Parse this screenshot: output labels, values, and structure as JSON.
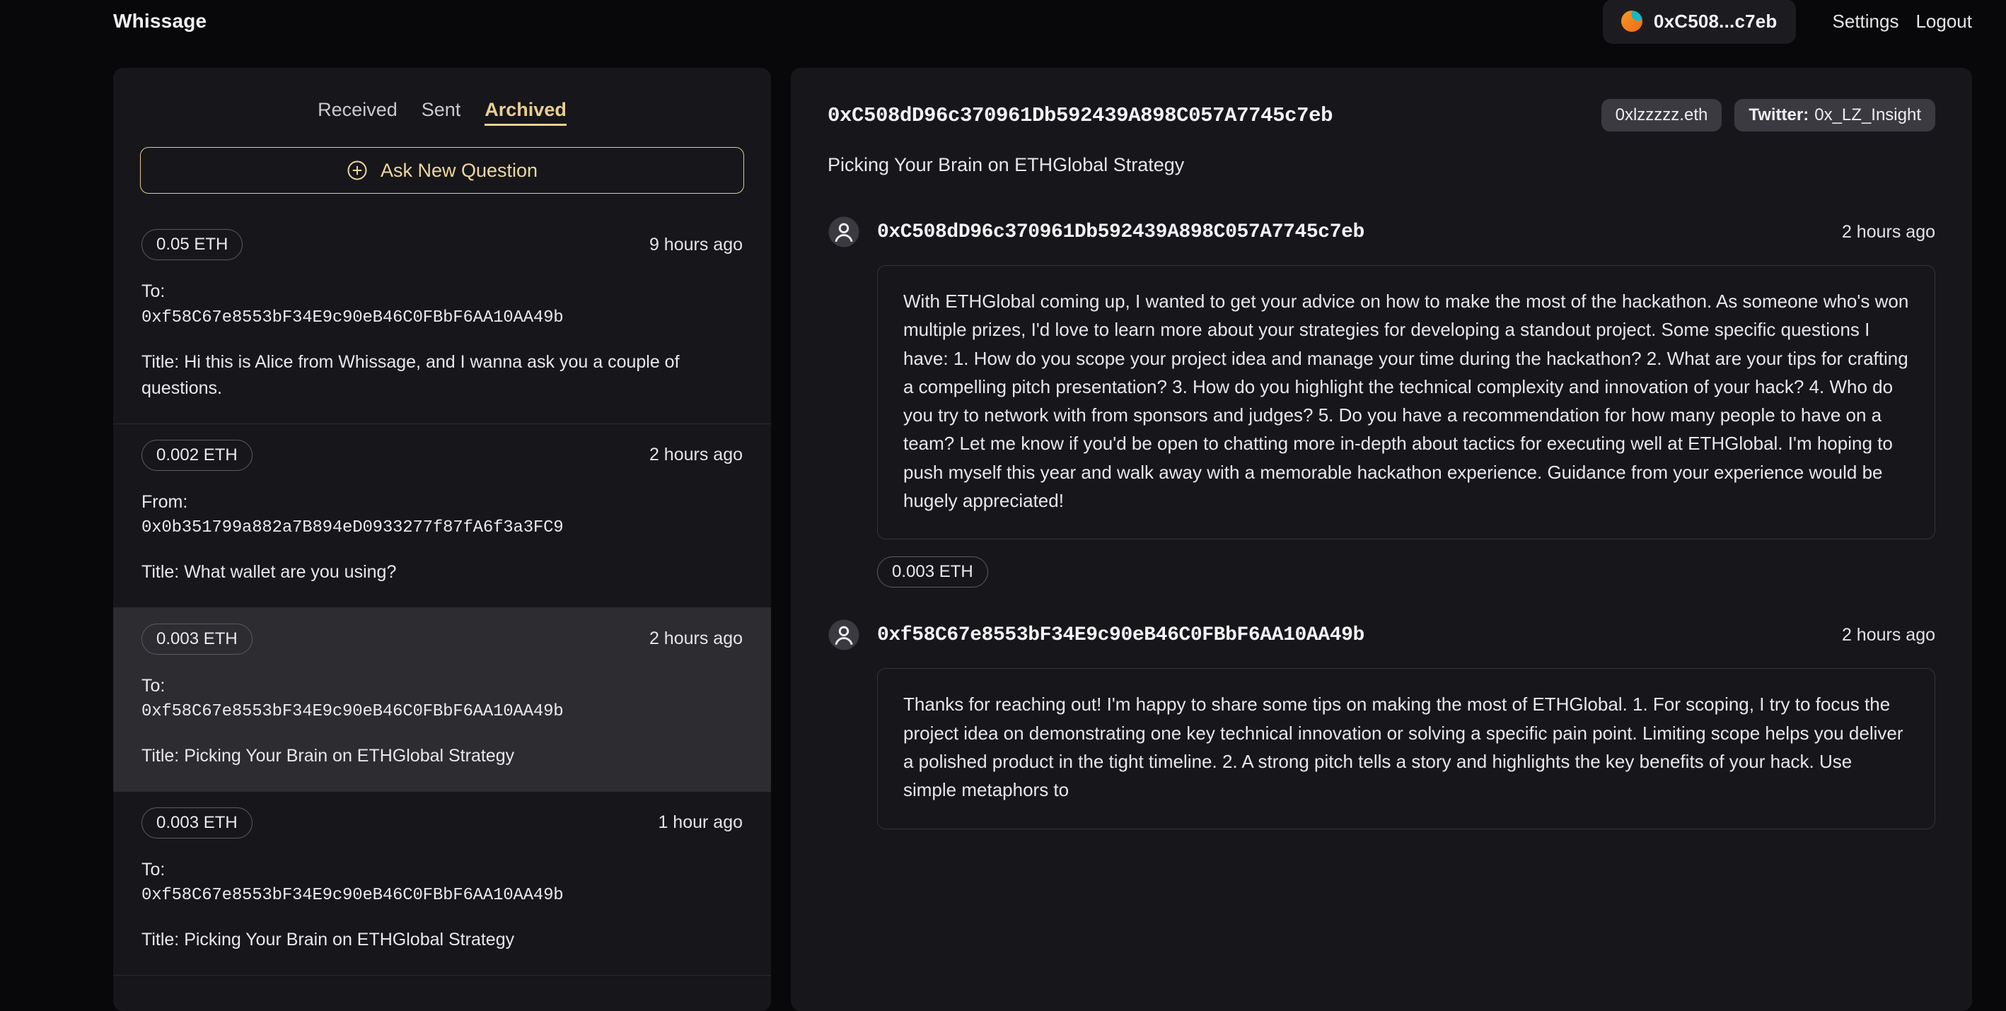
{
  "header": {
    "brand": "Whissage",
    "wallet_chip": {
      "icon": "wallet-avatar-icon",
      "address": "0xC508...c7eb"
    },
    "nav": [
      {
        "label": "Settings",
        "name": "settings-link"
      },
      {
        "label": "Logout",
        "name": "logout-link"
      }
    ]
  },
  "accent_color": "#e9cf92",
  "sidebar": {
    "tabs": [
      {
        "label": "Received",
        "active": false
      },
      {
        "label": "Sent",
        "active": false
      },
      {
        "label": "Archived",
        "active": true
      }
    ],
    "ask_button": {
      "icon": "plus-circle-icon",
      "label": "Ask New Question"
    },
    "items": [
      {
        "amount": "0.05 ETH",
        "time": "9 hours ago",
        "direction_label": "To:",
        "address": "0xf58C67e8553bF34E9c90eB46C0FBbF6AA10AA49b",
        "title": "Title: Hi this is Alice from Whissage, and I wanna ask you a couple of questions.",
        "selected": false
      },
      {
        "amount": "0.002 ETH",
        "time": "2 hours ago",
        "direction_label": "From:",
        "address": "0x0b351799a882a7B894eD0933277f87fA6f3a3FC9",
        "title": "Title: What wallet are you using?",
        "selected": false
      },
      {
        "amount": "0.003 ETH",
        "time": "2 hours ago",
        "direction_label": "To:",
        "address": "0xf58C67e8553bF34E9c90eB46C0FBbF6AA10AA49b",
        "title": "Title: Picking Your Brain on ETHGlobal Strategy",
        "selected": true
      },
      {
        "amount": "0.003 ETH",
        "time": "1 hour ago",
        "direction_label": "To:",
        "address": "0xf58C67e8553bF34E9c90eB46C0FBbF6AA10AA49b",
        "title": "Title: Picking Your Brain on ETHGlobal Strategy",
        "selected": false
      }
    ]
  },
  "main": {
    "address": "0xC508dD96c370961Db592439A898C057A7745c7eb",
    "badges": {
      "ens": "0xlzzzzz.eth",
      "twitter_label": "Twitter:",
      "twitter_handle": "0x_LZ_Insight"
    },
    "subject": "Picking Your Brain on ETHGlobal Strategy",
    "messages": [
      {
        "address": "0xC508dD96c370961Db592439A898C057A7745c7eb",
        "time": "2 hours ago",
        "body": "With ETHGlobal coming up, I wanted to get your advice on how to make the most of the hackathon. As someone who's won multiple prizes, I'd love to learn more about your strategies for developing a standout project. Some specific questions I have: 1. How do you scope your project idea and manage your time during the hackathon? 2. What are your tips for crafting a compelling pitch presentation? 3. How do you highlight the technical complexity and innovation of your hack? 4. Who do you try to network with from sponsors and judges? 5. Do you have a recommendation for how many people to have on a team? Let me know if you'd be open to chatting more in-depth about tactics for executing well at ETHGlobal. I'm hoping to push myself this year and walk away with a memorable hackathon experience. Guidance from your experience would be hugely appreciated!",
        "amount": "0.003 ETH"
      },
      {
        "address": "0xf58C67e8553bF34E9c90eB46C0FBbF6AA10AA49b",
        "time": "2 hours ago",
        "body": "Thanks for reaching out! I'm happy to share some tips on making the most of ETHGlobal. 1. For scoping, I try to focus the project idea on demonstrating one key technical innovation or solving a specific pain point. Limiting scope helps you deliver a polished product in the tight timeline. 2. A strong pitch tells a story and highlights the key benefits of your hack. Use simple metaphors to",
        "amount": ""
      }
    ]
  }
}
